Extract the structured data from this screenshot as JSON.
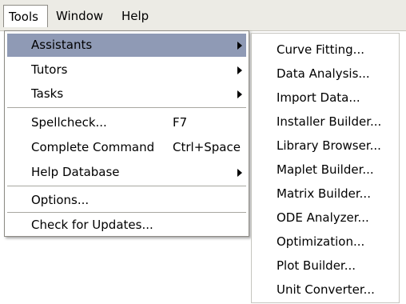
{
  "menubar": {
    "items": [
      {
        "label": "Tools"
      },
      {
        "label": "Window"
      },
      {
        "label": "Help"
      }
    ]
  },
  "tools_menu": {
    "items": [
      {
        "label": "Assistants",
        "has_submenu": true,
        "highlighted": true
      },
      {
        "label": "Tutors",
        "has_submenu": true
      },
      {
        "label": "Tasks",
        "has_submenu": true
      },
      {
        "label": "Spellcheck...",
        "shortcut": "F7"
      },
      {
        "label": "Complete Command",
        "shortcut": "Ctrl+Space"
      },
      {
        "label": "Help Database",
        "has_submenu": true
      },
      {
        "label": "Options..."
      },
      {
        "label": "Check for Updates..."
      }
    ]
  },
  "assistants_submenu": {
    "items": [
      {
        "label": "Curve Fitting..."
      },
      {
        "label": "Data Analysis..."
      },
      {
        "label": "Import Data..."
      },
      {
        "label": "Installer Builder..."
      },
      {
        "label": "Library Browser..."
      },
      {
        "label": "Maplet Builder..."
      },
      {
        "label": "Matrix Builder..."
      },
      {
        "label": "ODE Analyzer..."
      },
      {
        "label": "Optimization..."
      },
      {
        "label": "Plot Builder..."
      },
      {
        "label": "Unit Converter..."
      }
    ]
  },
  "colors": {
    "menubar_bg": "#ecebe5",
    "highlight": "#8f9ab5",
    "menu_bg": "#ffffff"
  }
}
